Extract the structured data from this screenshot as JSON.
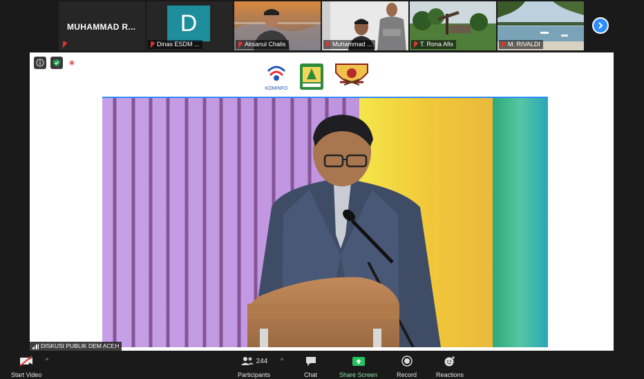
{
  "participants": [
    {
      "name": "MUHAMMAD  R...",
      "muted": false,
      "type": "name"
    },
    {
      "name": "Dinas ESDM ...",
      "initial": "D",
      "muted": true,
      "type": "avatar"
    },
    {
      "name": "Aksanul Chalis",
      "muted": true,
      "type": "video"
    },
    {
      "name": "Muhammad ...",
      "muted": true,
      "type": "video"
    },
    {
      "name": "T. Rona Afis",
      "muted": true,
      "type": "video"
    },
    {
      "name": "M. RIVALDI",
      "muted": true,
      "type": "video"
    }
  ],
  "logos": [
    "KOMINFO"
  ],
  "meeting_tag": "DISKUSI PUBLIK DEM ACEH",
  "toolbar": {
    "start_video": "Start Video",
    "participants_label": "Participants",
    "participants_count": "244",
    "chat": "Chat",
    "share_screen": "Share Screen",
    "record": "Record",
    "reactions": "Reactions"
  },
  "colors": {
    "accent": "#2d8cff",
    "share_green": "#22c55e",
    "mute_red": "#e0362f"
  }
}
